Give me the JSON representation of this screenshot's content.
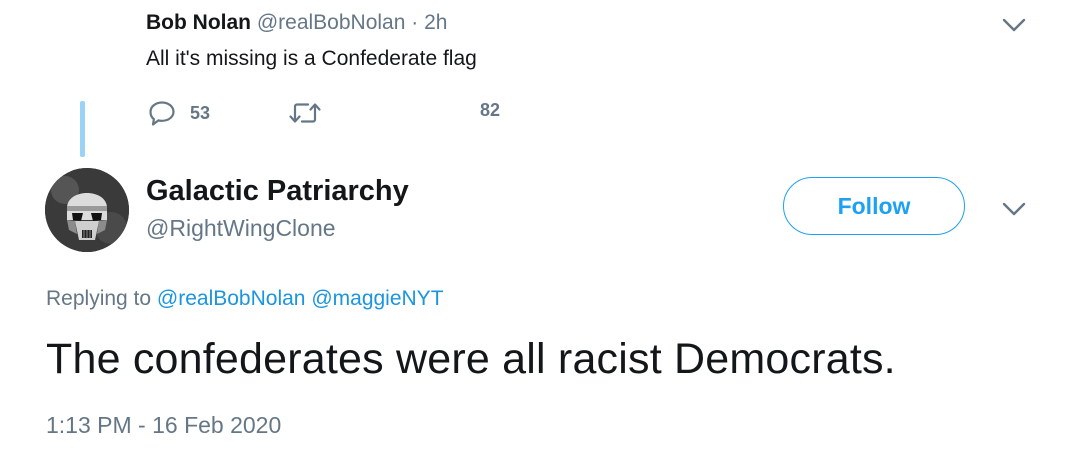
{
  "parent_tweet": {
    "display_name": "Bob Nolan",
    "handle": "@realBobNolan",
    "separator": "·",
    "time_ago": "2h",
    "text": "All it's missing is a Confederate flag",
    "reply_count": "53",
    "retweet_count": "",
    "like_count": "82",
    "icons": {
      "reply": "reply-icon",
      "retweet": "retweet-icon",
      "like": "like-icon",
      "menu": "chevron-down-icon"
    }
  },
  "main_tweet": {
    "display_name": "Galactic Patriarchy",
    "handle": "@RightWingClone",
    "follow_label": "Follow",
    "replying_prefix": "Replying to",
    "mentions": [
      "@realBobNolan",
      "@maggieNYT"
    ],
    "text": "The confederates were all racist Democrats.",
    "timestamp": "1:13 PM - 16 Feb 2020",
    "avatar_icon": "stormtrooper-avatar",
    "menu_icon": "chevron-down-icon"
  },
  "colors": {
    "accent": "#1da1f2",
    "mention": "#1b95e0",
    "secondary_text": "#657786",
    "primary_text": "#14171a",
    "thread_line": "#9ad3f5"
  }
}
